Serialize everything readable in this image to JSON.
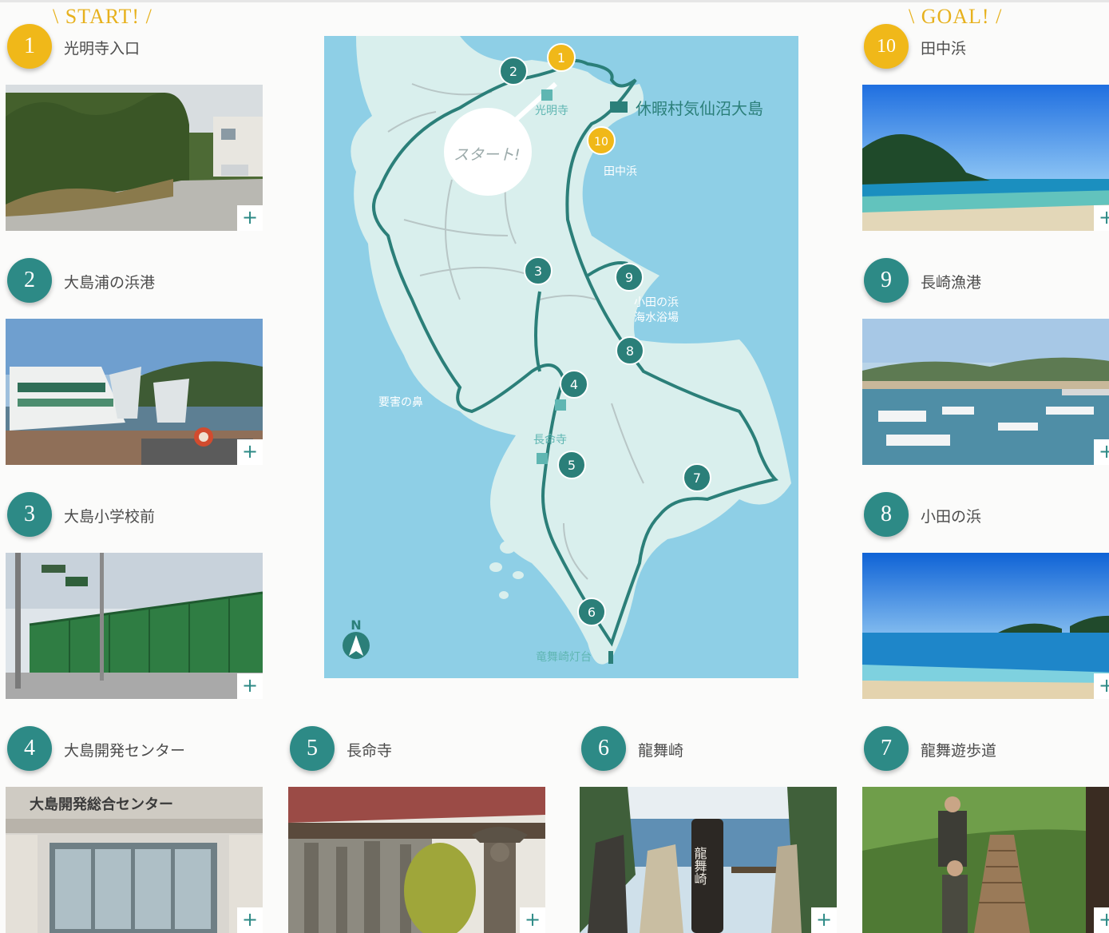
{
  "start_banner": "\\ START! /",
  "goal_banner": "\\ GOAL! /",
  "spots": [
    {
      "no": "1",
      "name": "光明寺入口"
    },
    {
      "no": "2",
      "name": "大島浦の浜港"
    },
    {
      "no": "3",
      "name": "大島小学校前"
    },
    {
      "no": "4",
      "name": "大島開発センター"
    },
    {
      "no": "5",
      "name": "長命寺"
    },
    {
      "no": "6",
      "name": "龍舞崎"
    },
    {
      "no": "7",
      "name": "龍舞遊歩道"
    },
    {
      "no": "8",
      "name": "小田の浜"
    },
    {
      "no": "9",
      "name": "長崎漁港"
    },
    {
      "no": "10",
      "name": "田中浜"
    }
  ],
  "expand_symbol": "+",
  "map": {
    "start_label": "スタート!",
    "places": {
      "komyoji": "光明寺",
      "kyukamura": "休暇村気仙沼大島",
      "tanakahama": "田中浜",
      "odanohama_1": "小田の浜",
      "odanohama_2": "海水浴場",
      "yogainohana": "要害の鼻",
      "chomeiji": "長命寺",
      "lighthouse": "竜舞崎灯台"
    },
    "compass": "N"
  },
  "photo_signs": {
    "center_sign": "大島開発総合センター",
    "ryumaizaki_sign": "龍舞崎"
  },
  "colors": {
    "teal": "#2d8a86",
    "gold": "#f0b819",
    "sea": "#8ecfe6",
    "land": "#d9efed",
    "route": "#2b7f79"
  }
}
